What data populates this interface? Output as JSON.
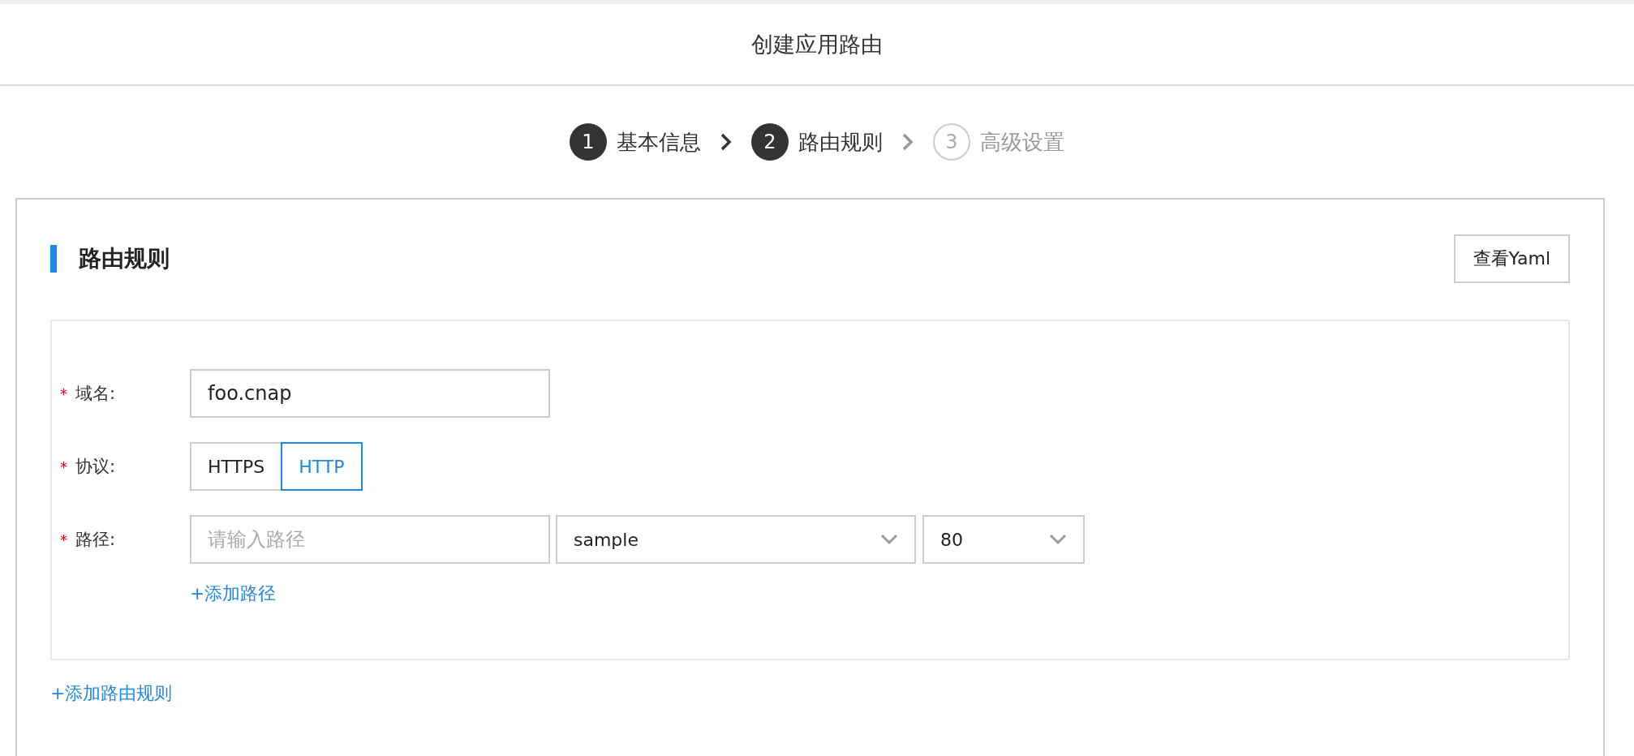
{
  "header": {
    "title": "创建应用路由"
  },
  "steps": [
    {
      "number": "1",
      "label": "基本信息",
      "active": true
    },
    {
      "number": "2",
      "label": "路由规则",
      "active": true
    },
    {
      "number": "3",
      "label": "高级设置",
      "active": false
    }
  ],
  "section": {
    "title": "路由规则",
    "yaml_button": "查看Yaml"
  },
  "form": {
    "domain": {
      "label": "域名:",
      "required_mark": "*",
      "value": "foo.cnap"
    },
    "protocol": {
      "label": "协议:",
      "required_mark": "*",
      "options": [
        {
          "label": "HTTPS",
          "selected": false
        },
        {
          "label": "HTTP",
          "selected": true
        }
      ]
    },
    "path": {
      "label": "路径:",
      "required_mark": "*",
      "placeholder": "请输入路径",
      "service": "sample",
      "port": "80"
    },
    "add_path": "+添加路径"
  },
  "add_rule": "+添加路由规则"
}
